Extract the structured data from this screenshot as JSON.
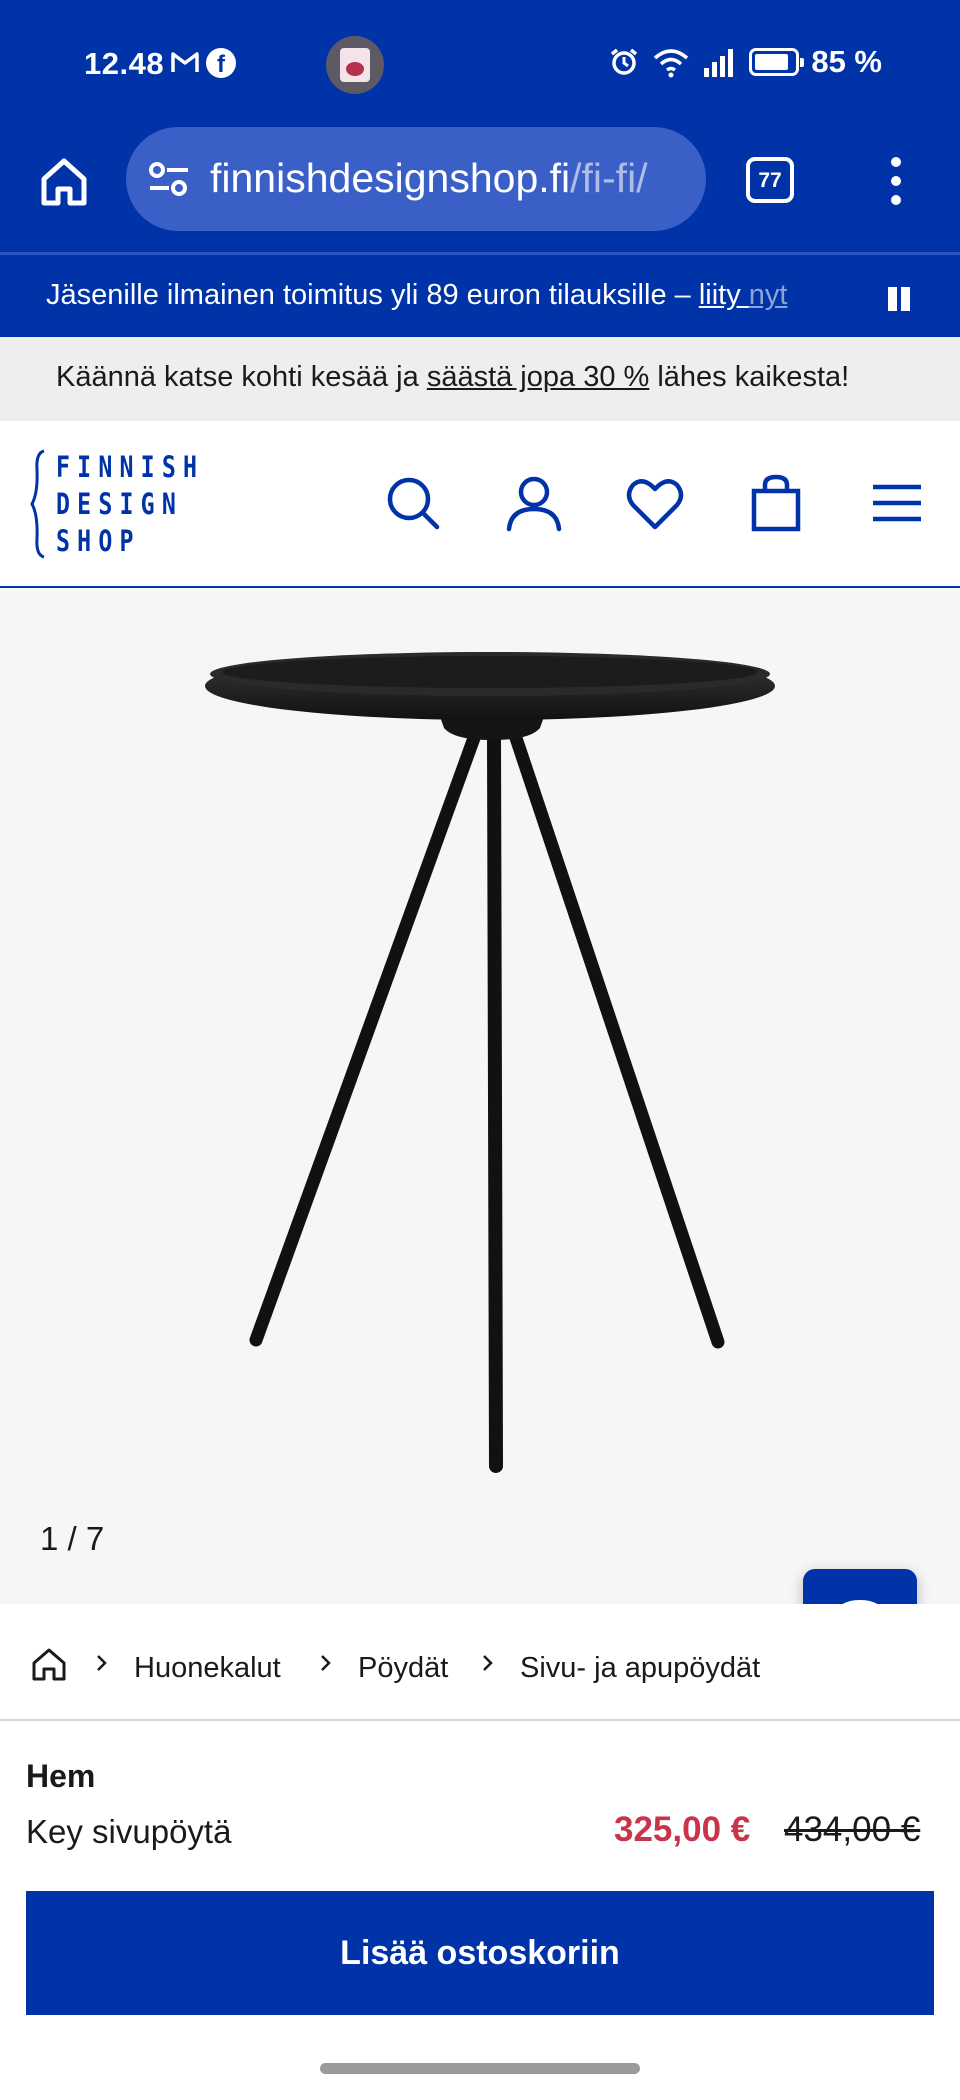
{
  "status_bar": {
    "time": "12.48",
    "battery": "85 %",
    "notification_icons": [
      "gmail-icon",
      "facebook-icon"
    ],
    "system_icons": [
      "alarm-icon",
      "wifi-icon",
      "signal-icon",
      "battery-icon"
    ],
    "battery_level": 0.85
  },
  "browser": {
    "url_domain": "finnishdesignshop.fi",
    "url_path": "/fi-fi/",
    "tab_count": "77"
  },
  "promo": {
    "text": "Jäsenille ilmainen toimitus yli 89 euron tilauksille – ",
    "link": "liity ",
    "link_faded": "nyt"
  },
  "sale_banner": {
    "before": "Käännä katse kohti kesää ja ",
    "link": "säästä jopa 30 %",
    "after": " lähes kaikesta!"
  },
  "logo": {
    "lines": [
      "FINNISH",
      "DESIGN",
      "SHOP"
    ]
  },
  "gallery": {
    "counter": "1 / 7"
  },
  "breadcrumb": {
    "items": [
      "Huonekalut",
      "Pöydät",
      "Sivu- ja apupöydät"
    ]
  },
  "product": {
    "brand": "Hem",
    "name": "Key sivupöytä",
    "price": "325,00 €",
    "old_price": "434,00 €",
    "cta": "Lisää ostoskoriin"
  },
  "colors": {
    "brand_blue": "#0033a8",
    "sale_red": "#c8344a"
  }
}
